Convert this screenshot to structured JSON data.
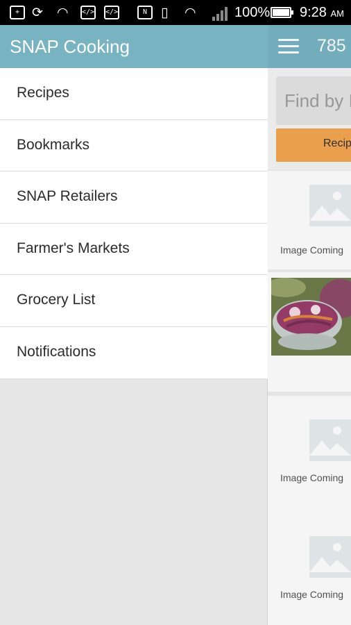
{
  "status_bar": {
    "icons": [
      "add-box-icon",
      "sync-icon",
      "wifi-icon",
      "code-icon",
      "code-icon",
      "nfc-icon",
      "vibrate-icon",
      "wifi-icon",
      "signal-icon",
      "battery-icon"
    ],
    "battery_percent": "100%",
    "battery_level": 1.0,
    "time": "9:28",
    "ampm": "AM"
  },
  "drawer": {
    "title": "SNAP Cooking",
    "items": [
      {
        "label": "Recipes"
      },
      {
        "label": "Bookmarks"
      },
      {
        "label": "SNAP Retailers"
      },
      {
        "label": "Farmer's Markets"
      },
      {
        "label": "Grocery List"
      },
      {
        "label": "Notifications"
      }
    ]
  },
  "main": {
    "count": "785",
    "search_placeholder": "Find by I",
    "recipes_button": "Recip",
    "cards": [
      {
        "image": "placeholder",
        "caption": "Image Coming"
      },
      {
        "image": "photo"
      },
      {
        "image": "placeholder",
        "caption": "Image Coming"
      },
      {
        "image": "placeholder",
        "caption": "Image Coming"
      }
    ]
  },
  "colors": {
    "app_bar": "#78b3c2",
    "accent_button": "#f3a64f"
  }
}
